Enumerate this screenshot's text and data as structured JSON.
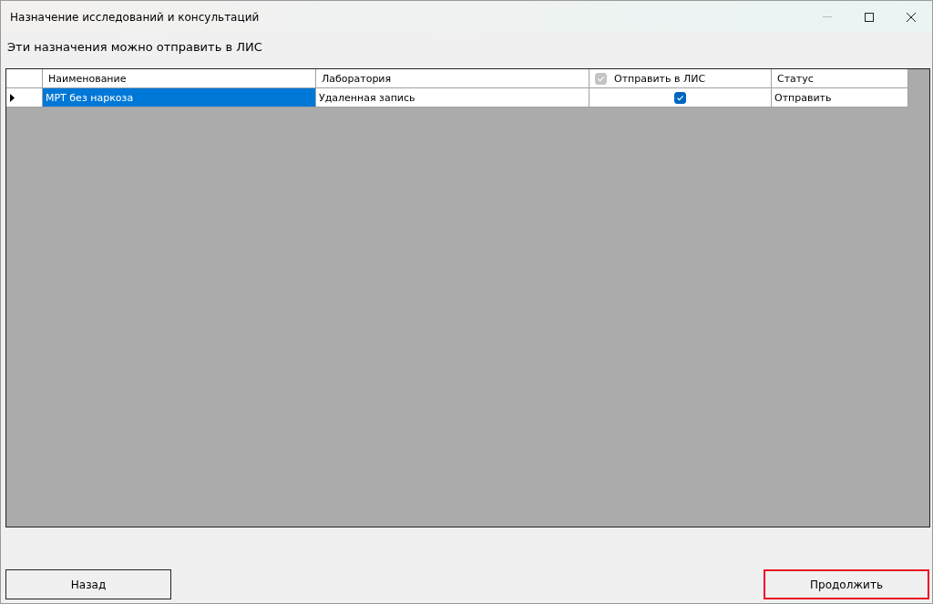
{
  "window": {
    "title": "Назначение исследований и консультаций"
  },
  "message": "Эти назначения можно отправить в ЛИС",
  "table": {
    "columns": [
      {
        "label": "Наименование",
        "kind": "text"
      },
      {
        "label": "Лаборатория",
        "kind": "text"
      },
      {
        "label": "Отправить в ЛИС",
        "kind": "check",
        "header_checked": true,
        "header_disabled": true
      },
      {
        "label": "Статус",
        "kind": "text"
      }
    ],
    "rows": [
      {
        "selected": true,
        "cells": [
          "МРТ без наркоза",
          "Удаленная запись",
          true,
          "Отправить"
        ]
      }
    ]
  },
  "buttons": [
    {
      "label": "Назад",
      "highlighted": false
    },
    {
      "label": "Продолжить",
      "highlighted": true
    }
  ]
}
